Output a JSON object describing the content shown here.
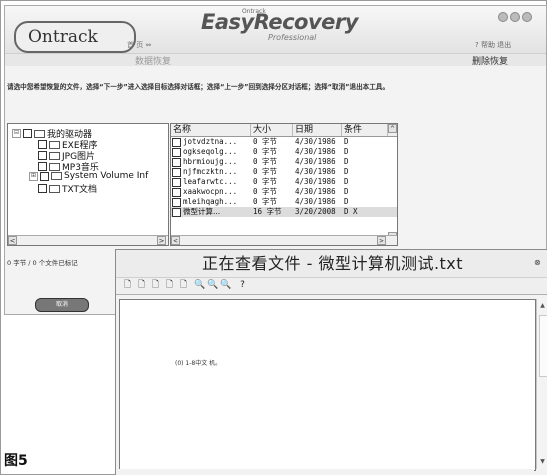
{
  "easyrecovery": {
    "brand_top": "Ontrack",
    "brand": "EasyRecovery",
    "brand_sub": "Professional",
    "logo": "Ontrack",
    "nav": "首 页 ⇔",
    "help": "? 帮助  退出",
    "title": "数据恢复",
    "section_title": "删除恢复",
    "instructions": "请选中您希望恢复的文件，选择“下一步”进入选择目标选择对话框；选择“上一步”回到选择分区对话框；选择“取消”退出本工具。",
    "tree": [
      {
        "label": "我的驱动器",
        "expander": "⊟"
      },
      {
        "label": "EXE程序",
        "expander": ""
      },
      {
        "label": "JPG图片",
        "expander": ""
      },
      {
        "label": "MP3音乐",
        "expander": ""
      },
      {
        "label": "System Volume Inf",
        "expander": "⊞"
      },
      {
        "label": "TXT文档",
        "expander": ""
      }
    ],
    "status": "0 字节 / 0 个文件已标记",
    "columns": [
      "名称",
      "大小",
      "日期",
      "条件"
    ],
    "rows": [
      {
        "name": "jotvdztna...",
        "size": "0 字节",
        "date": "4/30/1986",
        "cond": "D"
      },
      {
        "name": "ogkseqolg...",
        "size": "0 字节",
        "date": "4/30/1986",
        "cond": "D"
      },
      {
        "name": "hbrmioujg...",
        "size": "0 字节",
        "date": "4/30/1986",
        "cond": "D"
      },
      {
        "name": "njfmczktn...",
        "size": "0 字节",
        "date": "4/30/1986",
        "cond": "D"
      },
      {
        "name": "leafarwtc...",
        "size": "0 字节",
        "date": "4/30/1986",
        "cond": "D"
      },
      {
        "name": "xaakwocpn...",
        "size": "0 字节",
        "date": "4/30/1986",
        "cond": "D"
      },
      {
        "name": "mleihqagh...",
        "size": "0 字节",
        "date": "4/30/1986",
        "cond": "D"
      },
      {
        "name": "微型计算...",
        "size": "16 字节",
        "date": "3/20/2008",
        "cond": "D X"
      }
    ],
    "bottom_button": "取消"
  },
  "viewer": {
    "title": "正在查看文件 - 微型计算机测试.txt",
    "toolbar": [
      "🗋",
      "🗋",
      "🗋",
      "🗋",
      "🗋",
      "🔍",
      "🔍",
      "🔍",
      "?"
    ],
    "content": "(0) 1-8中文 机。"
  },
  "figure_label": "图5"
}
